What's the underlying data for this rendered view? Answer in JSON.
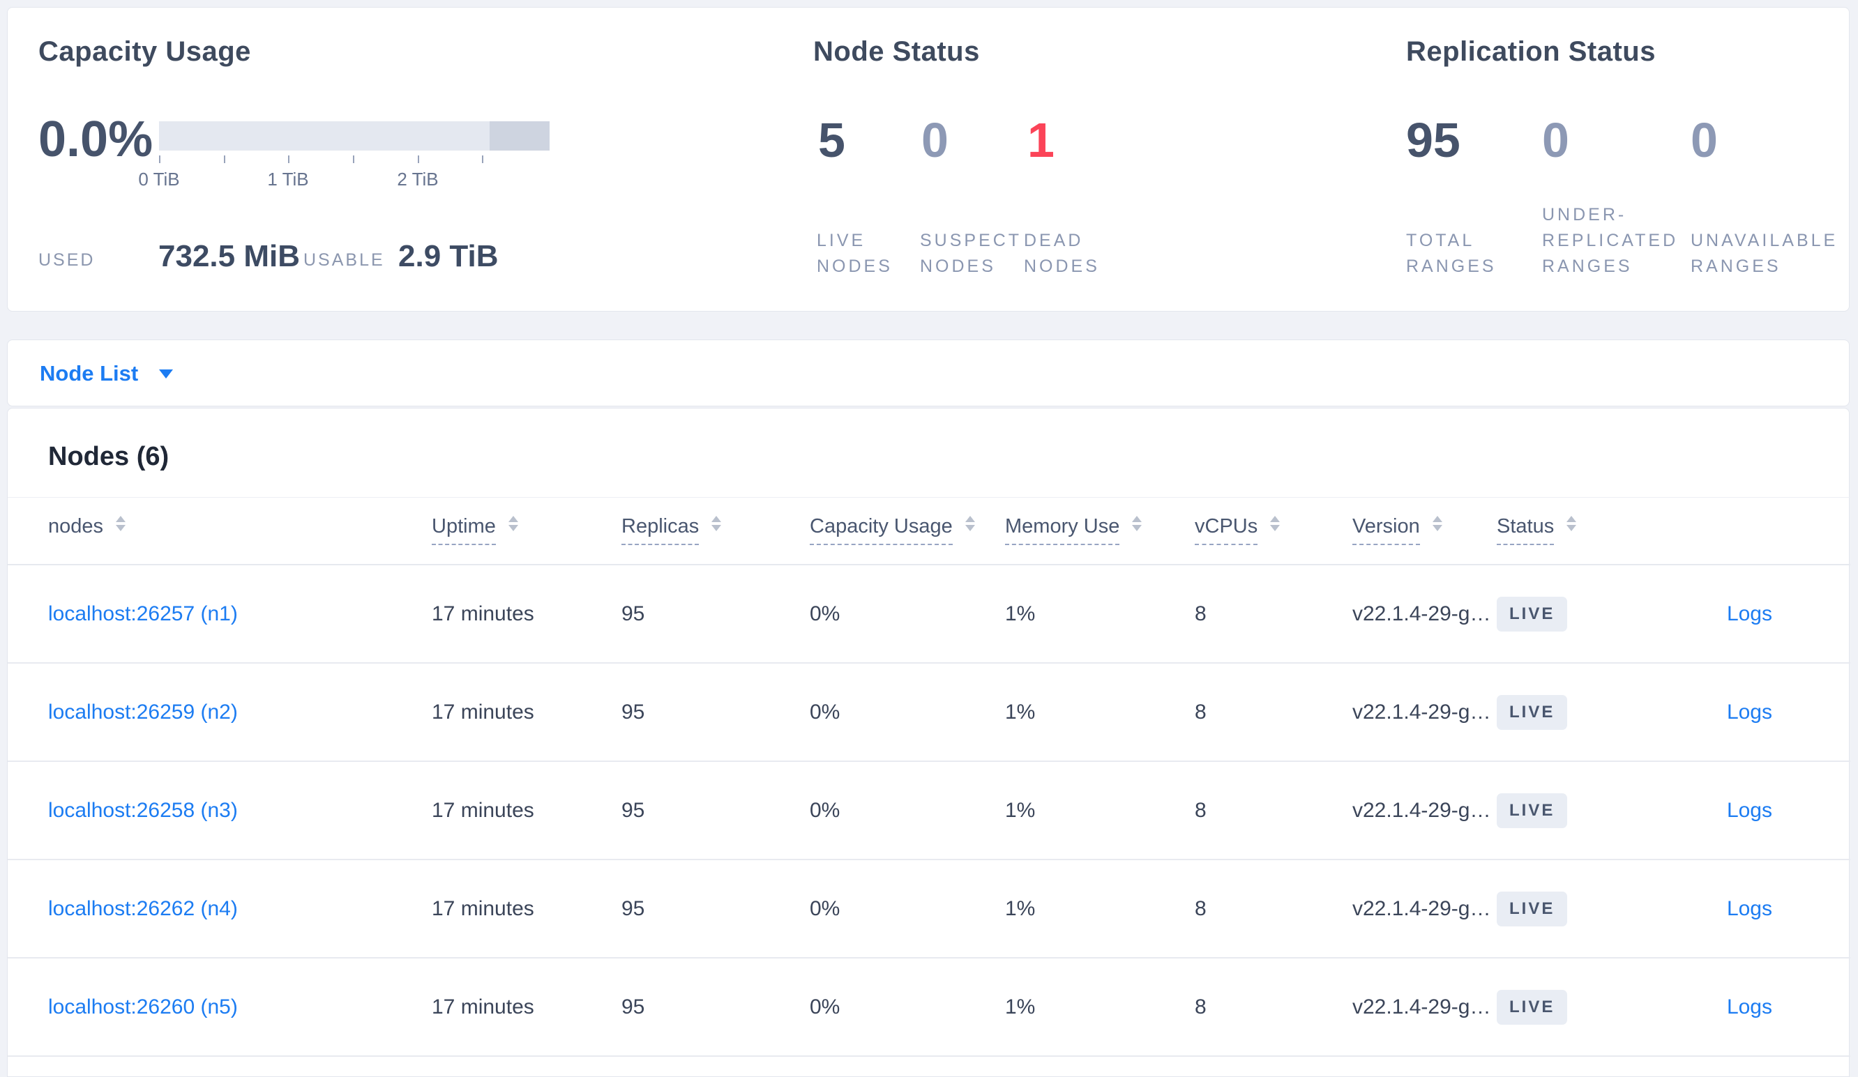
{
  "colors": {
    "link_blue": "#1c7cf2",
    "dead_red": "#fb4458",
    "stat_dark": "#46536b",
    "stat_muted": "#8d99b5",
    "badge_bg": "#e9edf4",
    "page_bg": "#f0f2f7",
    "bar_track": "#e4e8f0",
    "bar_dark_segment": "#ced4e0"
  },
  "capacity": {
    "title": "Capacity Usage",
    "percent": "0.0%",
    "axis_ticks": [
      "0 TiB",
      "1 TiB",
      "2 TiB"
    ],
    "used_label": "USED",
    "used_value": "732.5 MiB",
    "usable_label": "USABLE",
    "usable_value": "2.9 TiB"
  },
  "node_status": {
    "title": "Node Status",
    "stats": [
      {
        "value": "5",
        "lines": [
          "LIVE",
          "NODES"
        ]
      },
      {
        "value": "0",
        "lines": [
          "SUSPECT",
          "NODES"
        ]
      },
      {
        "value": "1",
        "lines": [
          "DEAD",
          "NODES"
        ]
      }
    ]
  },
  "replication": {
    "title": "Replication Status",
    "stats": [
      {
        "value": "95",
        "lines": [
          "TOTAL",
          "RANGES"
        ]
      },
      {
        "value": "0",
        "lines": [
          "UNDER-",
          "REPLICATED",
          "RANGES"
        ]
      },
      {
        "value": "0",
        "lines": [
          "UNAVAILABLE",
          "RANGES"
        ]
      }
    ]
  },
  "node_list": {
    "label": "Node List"
  },
  "nodes_table": {
    "title": "Nodes (6)",
    "columns": [
      {
        "label": "nodes"
      },
      {
        "label": "Uptime"
      },
      {
        "label": "Replicas"
      },
      {
        "label": "Capacity Usage"
      },
      {
        "label": "Memory Use"
      },
      {
        "label": "vCPUs"
      },
      {
        "label": "Version"
      },
      {
        "label": "Status"
      }
    ],
    "rows": [
      {
        "node": "localhost:26257 (n1)",
        "uptime": "17 minutes",
        "replicas": "95",
        "capacity": "0%",
        "memory": "1%",
        "vcpus": "8",
        "version": "v22.1.4-29-g…",
        "status": "LIVE",
        "logs": "Logs"
      },
      {
        "node": "localhost:26259 (n2)",
        "uptime": "17 minutes",
        "replicas": "95",
        "capacity": "0%",
        "memory": "1%",
        "vcpus": "8",
        "version": "v22.1.4-29-g…",
        "status": "LIVE",
        "logs": "Logs"
      },
      {
        "node": "localhost:26258 (n3)",
        "uptime": "17 minutes",
        "replicas": "95",
        "capacity": "0%",
        "memory": "1%",
        "vcpus": "8",
        "version": "v22.1.4-29-g…",
        "status": "LIVE",
        "logs": "Logs"
      },
      {
        "node": "localhost:26262 (n4)",
        "uptime": "17 minutes",
        "replicas": "95",
        "capacity": "0%",
        "memory": "1%",
        "vcpus": "8",
        "version": "v22.1.4-29-g…",
        "status": "LIVE",
        "logs": "Logs"
      },
      {
        "node": "localhost:26260 (n5)",
        "uptime": "17 minutes",
        "replicas": "95",
        "capacity": "0%",
        "memory": "1%",
        "vcpus": "8",
        "version": "v22.1.4-29-g…",
        "status": "LIVE",
        "logs": "Logs"
      }
    ]
  },
  "chart_data": {
    "type": "bar",
    "title": "Capacity Usage",
    "categories": [
      "capacity"
    ],
    "values": [
      0.0
    ],
    "xlabel": "TiB",
    "ylabel": "",
    "axis_range_tib": [
      0,
      2.9
    ],
    "axis_tick_labels": [
      "0 TiB",
      "1 TiB",
      "2 TiB"
    ],
    "used": "732.5 MiB",
    "usable": "2.9 TiB",
    "percent_used": "0.0%"
  }
}
